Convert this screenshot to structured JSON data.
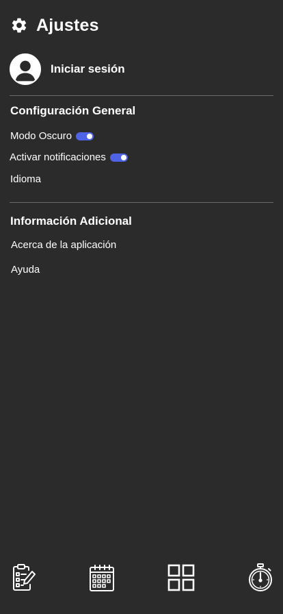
{
  "header": {
    "title": "Ajustes",
    "icon": "gear-icon"
  },
  "account": {
    "login_label": "Iniciar sesión",
    "icon": "user-avatar-icon"
  },
  "general": {
    "title": "Configuración General",
    "dark_mode": {
      "label": "Modo Oscuro",
      "enabled": true
    },
    "notifications": {
      "label": "Activar notificaciones",
      "enabled": true
    },
    "language": {
      "label": "Idioma"
    }
  },
  "additional": {
    "title": "Información Adicional",
    "about": "Acerca de la aplicación",
    "help": "Ayuda"
  },
  "bottom_nav": {
    "items": [
      {
        "icon": "clipboard-edit-icon"
      },
      {
        "icon": "calendar-icon"
      },
      {
        "icon": "grid-icon"
      },
      {
        "icon": "stopwatch-icon"
      }
    ]
  },
  "colors": {
    "background": "#2b2b2b",
    "text": "#ffffff",
    "toggle_on": "#4f63e6",
    "divider": "#6a6a6a"
  }
}
